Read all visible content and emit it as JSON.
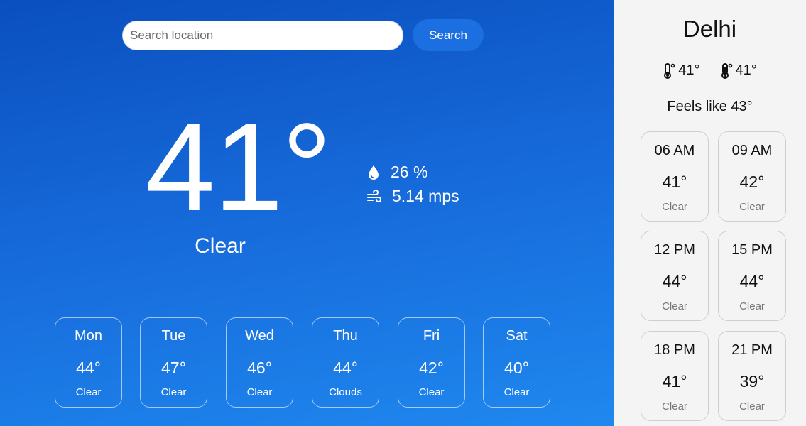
{
  "search": {
    "placeholder": "Search location",
    "button_label": "Search"
  },
  "current": {
    "temperature": "41°",
    "condition": "Clear",
    "humidity": "26 %",
    "wind": "5.14 mps"
  },
  "forecast": [
    {
      "day": "Mon",
      "temp": "44°",
      "condition": "Clear"
    },
    {
      "day": "Tue",
      "temp": "47°",
      "condition": "Clear"
    },
    {
      "day": "Wed",
      "temp": "46°",
      "condition": "Clear"
    },
    {
      "day": "Thu",
      "temp": "44°",
      "condition": "Clouds"
    },
    {
      "day": "Fri",
      "temp": "42°",
      "condition": "Clear"
    },
    {
      "day": "Sat",
      "temp": "40°",
      "condition": "Clear"
    }
  ],
  "sidebar": {
    "city": "Delhi",
    "temp_min": "41°",
    "temp_max": "41°",
    "feels_like": "Feels like 43°",
    "hourly": [
      {
        "time": "06 AM",
        "temp": "41°",
        "condition": "Clear"
      },
      {
        "time": "09 AM",
        "temp": "42°",
        "condition": "Clear"
      },
      {
        "time": "12 PM",
        "temp": "44°",
        "condition": "Clear"
      },
      {
        "time": "15 PM",
        "temp": "44°",
        "condition": "Clear"
      },
      {
        "time": "18 PM",
        "temp": "41°",
        "condition": "Clear"
      },
      {
        "time": "21 PM",
        "temp": "39°",
        "condition": "Clear"
      }
    ]
  },
  "icons": {
    "humidity": "water-drop-icon",
    "wind": "wind-icon",
    "min": "thermometer-low-icon",
    "max": "thermometer-high-icon"
  },
  "colors": {
    "gradient_top": "#0a4fbf",
    "gradient_bottom": "#1f88ef",
    "search_button": "#1b6fe0",
    "sidebar_bg": "#f4f4f4"
  }
}
